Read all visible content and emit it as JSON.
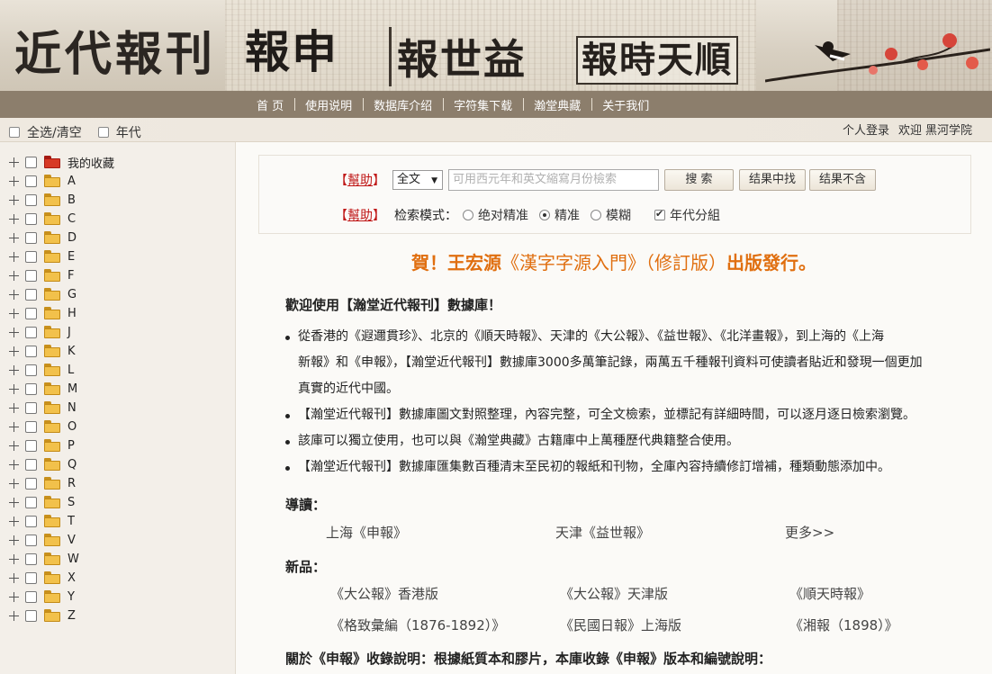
{
  "header": {
    "brand": "近代報刊",
    "newspaper_1": "報申",
    "newspaper_2": "報世益",
    "newspaper_3": "報時天順"
  },
  "nav": {
    "items": [
      "首 页",
      "使用说明",
      "数据库介绍",
      "字符集下载",
      "瀚堂典藏",
      "关于我们"
    ]
  },
  "subbar": {
    "select_all": "全选/清空",
    "year": "年代",
    "login": "个人登录",
    "welcome": "欢迎",
    "user": "黑河学院"
  },
  "sidebar": {
    "favorites": "我的收藏",
    "letters": [
      "A",
      "B",
      "C",
      "D",
      "E",
      "F",
      "G",
      "H",
      "J",
      "K",
      "L",
      "M",
      "N",
      "O",
      "P",
      "Q",
      "R",
      "S",
      "T",
      "V",
      "W",
      "X",
      "Y",
      "Z"
    ]
  },
  "search": {
    "help": "幫助",
    "scope_selected": "全文",
    "placeholder": "可用西元年和英文縮寫月份檢索",
    "search_btn": "搜 索",
    "within_btn": "结果中找",
    "exclude_btn": "结果不含",
    "mode_label": "检索模式：",
    "modes": [
      {
        "label": "绝对精准",
        "selected": false
      },
      {
        "label": "精准",
        "selected": true
      },
      {
        "label": "模糊",
        "selected": false
      }
    ],
    "group_label": "年代分組",
    "group_checked": true
  },
  "content": {
    "announce_pre": "賀！王宏源",
    "announce_mid": "《漢字字源入門》（修訂版）",
    "announce_post": "出版發行。",
    "welcome": "歡迎使用【瀚堂近代報刊】數據庫！",
    "bullets": [
      "從香港的《遐邇貫珍》、北京的《順天時報》、天津的《大公報》、《益世報》、《北洋畫報》，到上海的《上海",
      "新報》和《申報》，【瀚堂近代報刊】數據庫3000多萬筆記錄，兩萬五千種報刊資料可使讀者貼近和發現一個更加",
      "真實的近代中國。",
      "【瀚堂近代報刊】數據庫圖文對照整理，內容完整，可全文檢索，並標記有詳細時間，可以逐月逐日檢索瀏覽。",
      "該庫可以獨立使用，也可以與《瀚堂典藏》古籍庫中上萬種歷代典籍整合使用。",
      "【瀚堂近代報刊】數據庫匯集數百種清末至民初的報紙和刊物，全庫內容持續修訂增補，種類動態添加中。"
    ],
    "guide_title": "導讀：",
    "guide_links": [
      "上海《申報》",
      "天津《益世報》",
      "更多>>"
    ],
    "new_title": "新品：",
    "new_row1": [
      "《大公報》香港版",
      "《大公報》天津版",
      "《順天時報》"
    ],
    "new_row2": [
      "《格致彙編（1876-1892）》",
      "《民國日報》上海版",
      "《湘報（1898）》"
    ],
    "note_title": "關於《申報》收錄說明：根據紙質本和膠片，本庫收錄《申報》版本和編號說明："
  },
  "colors": {
    "nav_bg": "#8c7e6c",
    "help_red": "#c01818",
    "announce_orange": "#e06f10"
  }
}
